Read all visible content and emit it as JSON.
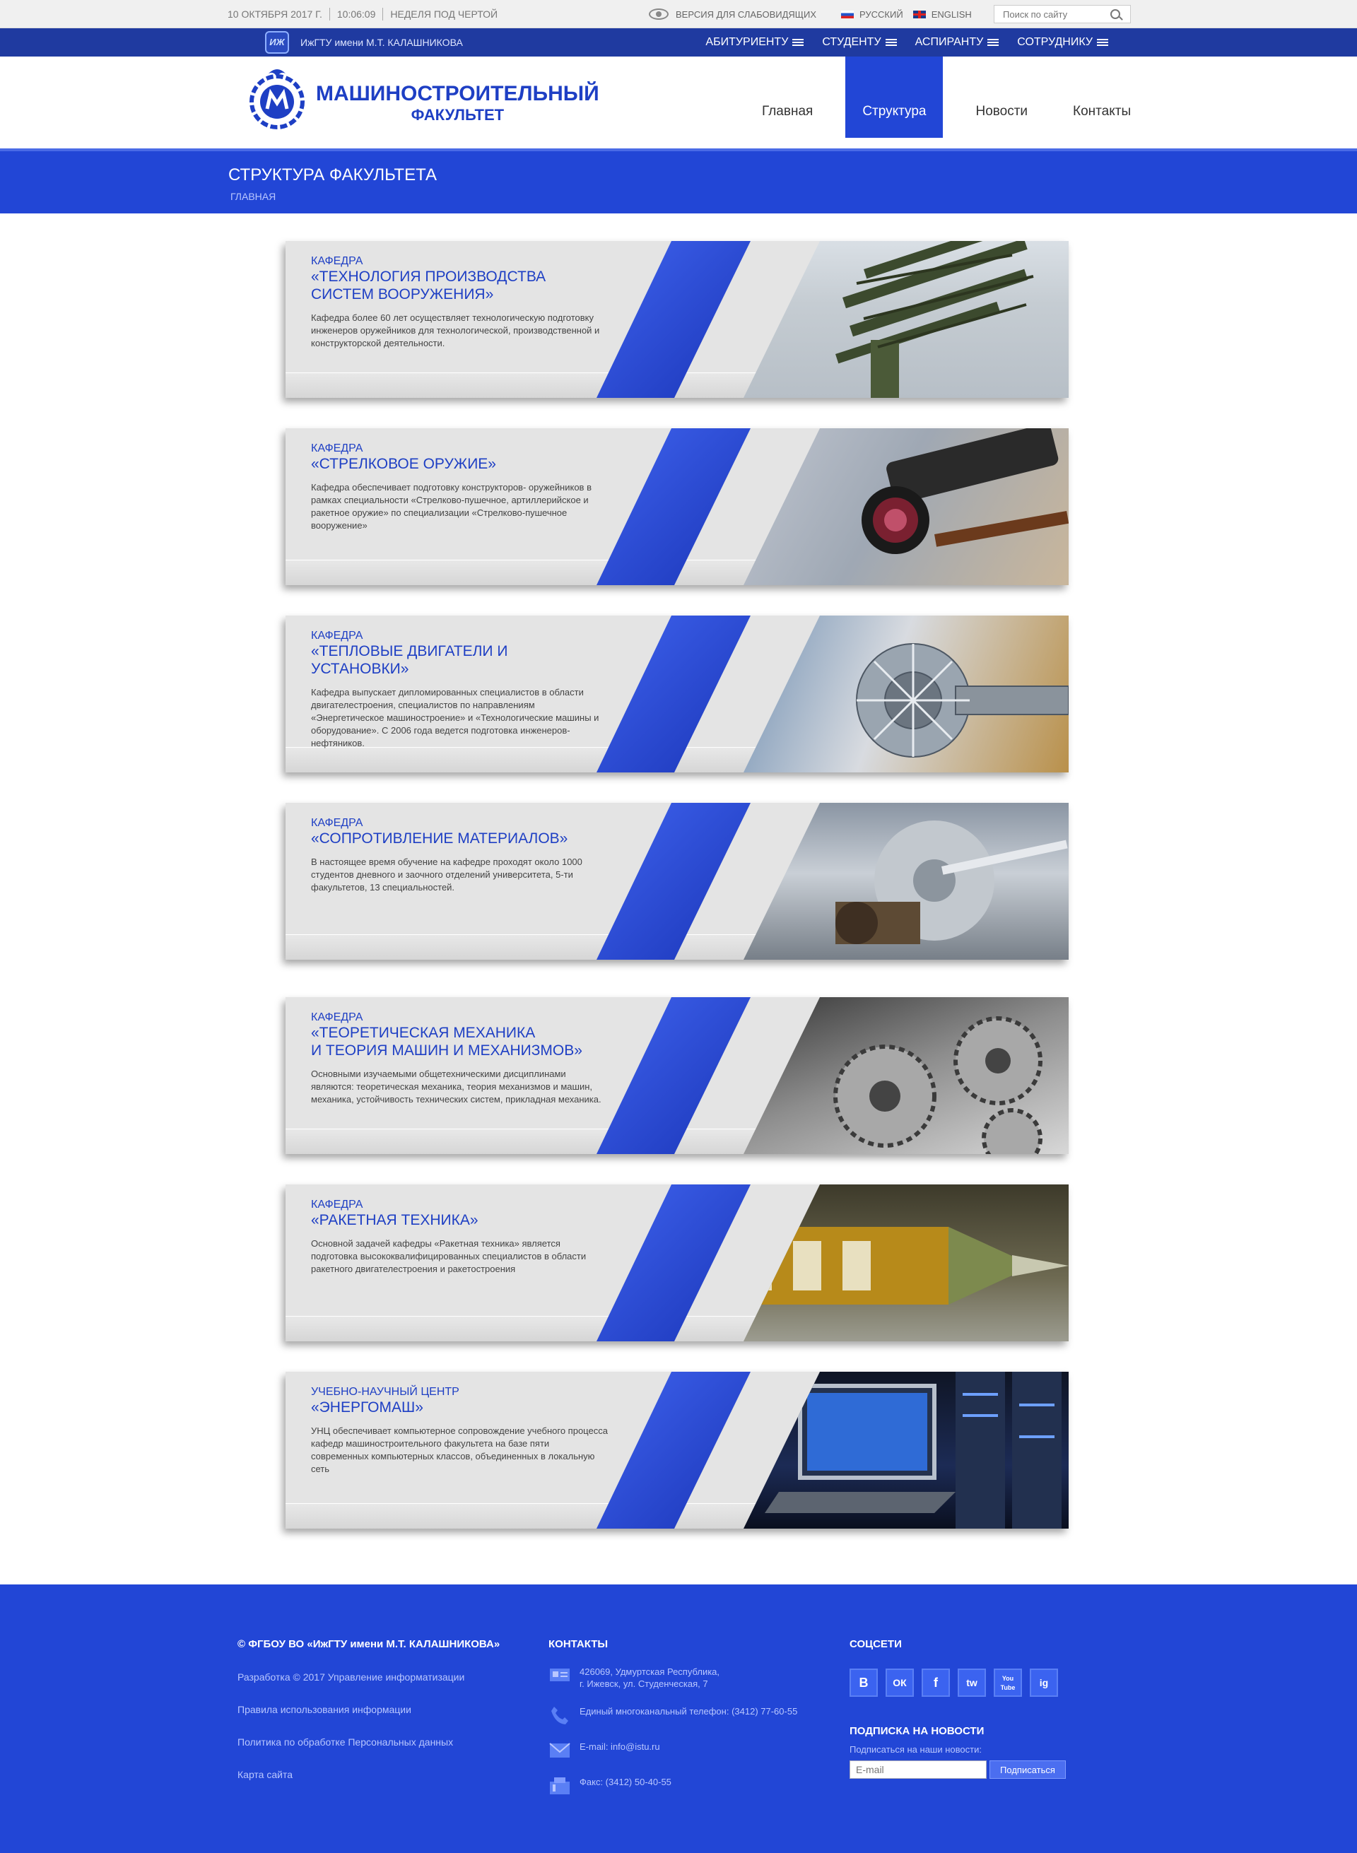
{
  "topbar": {
    "date": "10 ОКТЯБРЯ 2017 Г.",
    "time": "10:06:09",
    "week": "НЕДЕЛЯ ПОД ЧЕРТОЙ",
    "vision": "ВЕРСИЯ ДЛЯ СЛАБОВИДЯЩИХ",
    "lang_ru": "РУССКИЙ",
    "lang_en": "ENGLISH",
    "search_placeholder": "Поиск по сайту"
  },
  "uni": {
    "logo": "ИЖ",
    "name": "ИжГТУ имени М.Т. КАЛАШНИКОВА",
    "nav": [
      "АБИТУРИЕНТУ",
      "СТУДЕНТУ",
      "АСПИРАНТУ",
      "СОТРУДНИКУ"
    ]
  },
  "header": {
    "title1": "МАШИНОСТРОИТЕЛЬНЫЙ",
    "title2": "ФАКУЛЬТЕТ",
    "nav": [
      "Главная",
      "Структура",
      "Новости",
      "Контакты"
    ],
    "active": "Структура"
  },
  "page": {
    "title": "СТРУКТУРА ФАКУЛЬТЕТА",
    "breadcrumb": "ГЛАВНАЯ"
  },
  "cards": [
    {
      "kicker": "КАФЕДРА",
      "title1": "«ТЕХНОЛОГИЯ ПРОИЗВОДСТВА",
      "title2": "СИСТЕМ ВООРУЖЕНИЯ»",
      "desc": "Кафедра более 60 лет осуществляет технологическую подготовку инженеров оружейников для технологической, производственной и конструкторской деятельности.",
      "photo": "missile-launcher"
    },
    {
      "kicker": "КАФЕДРА",
      "title1": "«СТРЕЛКОВОЕ ОРУЖИЕ»",
      "title2": "",
      "desc": "Кафедра обеспечивает подготовку конструкторов- оружейников в рамках специальности «Стрелково-пушечное, артиллерийское и ракетное оружие» по специализации «Стрелково-пушечное вооружение»",
      "photo": "rifle-scope"
    },
    {
      "kicker": "КАФЕДРА",
      "title1": "«ТЕПЛОВЫЕ ДВИГАТЕЛИ И УСТАНОВКИ»",
      "title2": "",
      "desc": "Кафедра выпускает дипломированных специалистов в области двигателестроения, специалистов по направлениям «Энергетическое машиностроение» и «Технологические машины и оборудование». С 2006 года ведется подготовка инженеров-нефтяников.",
      "photo": "turbine"
    },
    {
      "kicker": "КАФЕДРА",
      "title1": "«СОПРОТИВЛЕНИЕ МАТЕРИАЛОВ»",
      "title2": "",
      "desc": "В настоящее время обучение на кафедре проходят около 1000 студентов дневного и заочного отделений университета, 5-ти факультетов, 13 специальностей.",
      "photo": "steel-roll"
    },
    {
      "kicker": "КАФЕДРА",
      "title1": "«ТЕОРЕТИЧЕСКАЯ МЕХАНИКА",
      "title2": "И ТЕОРИЯ МАШИН И МЕХАНИЗМОВ»",
      "desc": "Основными изучаемыми общетехническими дисциплинами являются: теоретическая механика, теория механизмов и машин, механика, устойчивость технических систем, прикладная механика.",
      "photo": "gears"
    },
    {
      "kicker": "КАФЕДРА",
      "title1": "«РАКЕТНАЯ ТЕХНИКА»",
      "title2": "",
      "desc": "Основной задачей кафедры «Ракетная техника» является подготовка высококвалифицированных специалистов в области ракетного двигателестроения и ракетостроения",
      "photo": "rocket"
    },
    {
      "kicker": "УЧЕБНО-НАУЧНЫЙ ЦЕНТР",
      "title1": "«ЭНЕРГОМАШ»",
      "title2": "",
      "desc": "УНЦ обеспечивает компьютерное сопровождение учебного процесса кафедр машиностроительного факультета на базе пяти современных компьютерных классов, объединенных в локальную сеть",
      "photo": "servers"
    }
  ],
  "footer": {
    "copyright": "© ФГБОУ ВО «ИжГТУ имени М.Т. КАЛАШНИКОВА»",
    "links": [
      "Разработка © 2017 Управление информатизации",
      "Правила использования информации",
      "Политика по обработке Персональных данных",
      "Карта сайта"
    ],
    "contacts_title": "КОНТАКТЫ",
    "address": "426069, Удмуртская Республика,\nг. Ижевск, ул. Студенческая, 7",
    "phone": "Единый многоканальный телефон: (3412) 77-60-55",
    "email": "E-mail: info@istu.ru",
    "fax": "Факс: (3412) 50-40-55",
    "social_title": "СОЦСЕТИ",
    "socials": [
      "В",
      "ОК",
      "f",
      "tw",
      "You Tube",
      "ig"
    ],
    "subscribe_title": "ПОДПИСКА НА НОВОСТИ",
    "subscribe_text": "Подписаться на наши новости:",
    "email_placeholder": "E-mail",
    "subscribe_button": "Подписаться"
  },
  "colors": {
    "brand": "#2246d6",
    "dark": "#1f3aa0",
    "title": "#1e3fc4"
  }
}
